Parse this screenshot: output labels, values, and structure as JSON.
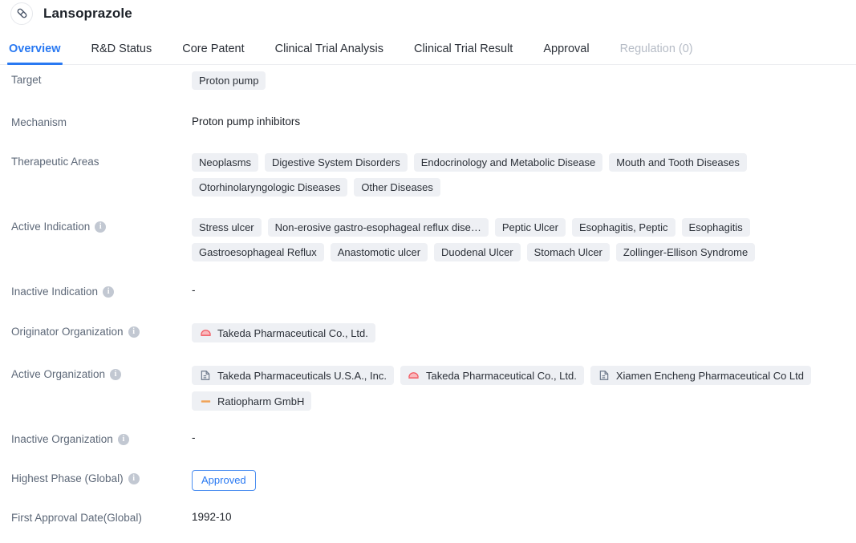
{
  "header": {
    "drug_name": "Lansoprazole",
    "avatar_icon": "capsule-pill-icon"
  },
  "tabs": [
    {
      "label": "Overview",
      "state": "active"
    },
    {
      "label": "R&D Status",
      "state": "normal"
    },
    {
      "label": "Core Patent",
      "state": "normal"
    },
    {
      "label": "Clinical Trial Analysis",
      "state": "normal"
    },
    {
      "label": "Clinical Trial Result",
      "state": "normal"
    },
    {
      "label": "Approval",
      "state": "normal"
    },
    {
      "label": "Regulation (0)",
      "state": "disabled"
    }
  ],
  "colors": {
    "accent": "#2979f2",
    "chip_bg": "#eef0f4",
    "label_text": "#5d6878",
    "value_text": "#20242b",
    "disabled_text": "#b6bcc6",
    "takeda_logo": "#f2565f",
    "ratiopharm_logo": "#f0a257",
    "company_icon": "#6b7789"
  },
  "rows": {
    "target": {
      "label": "Target",
      "chips": [
        "Proton pump"
      ]
    },
    "mechanism": {
      "label": "Mechanism",
      "text": "Proton pump inhibitors"
    },
    "therapeutic_areas": {
      "label": "Therapeutic Areas",
      "chips": [
        "Neoplasms",
        "Digestive System Disorders",
        "Endocrinology and Metabolic Disease",
        "Mouth and Tooth Diseases",
        "Otorhinolaryngologic Diseases",
        "Other Diseases"
      ]
    },
    "active_indication": {
      "label": "Active Indication",
      "info": "i",
      "chips": [
        "Stress ulcer",
        "Non-erosive gastro-esophageal reflux dise…",
        "Peptic Ulcer",
        "Esophagitis, Peptic",
        "Esophagitis",
        "Gastroesophageal Reflux",
        "Anastomotic ulcer",
        "Duodenal Ulcer",
        "Stomach Ulcer",
        "Zollinger-Ellison Syndrome"
      ]
    },
    "inactive_indication": {
      "label": "Inactive Indication",
      "info": "i",
      "text": "-"
    },
    "originator_organization": {
      "label": "Originator Organization",
      "info": "i",
      "chips": [
        {
          "text": "Takeda Pharmaceutical Co., Ltd.",
          "logo": "takeda-logo-icon"
        }
      ]
    },
    "active_organization": {
      "label": "Active Organization",
      "info": "i",
      "chips": [
        {
          "text": "Takeda Pharmaceuticals U.S.A., Inc.",
          "logo": "company-building-icon"
        },
        {
          "text": "Takeda Pharmaceutical Co., Ltd.",
          "logo": "takeda-logo-icon"
        },
        {
          "text": "Xiamen Encheng Pharmaceutical Co Ltd",
          "logo": "company-building-icon"
        },
        {
          "text": "Ratiopharm GmbH",
          "logo": "ratiopharm-logo-icon"
        }
      ]
    },
    "inactive_organization": {
      "label": "Inactive Organization",
      "info": "i",
      "text": "-"
    },
    "highest_phase": {
      "label": "Highest Phase (Global)",
      "info": "i",
      "badge": "Approved"
    },
    "first_approval_date": {
      "label": "First Approval Date(Global)",
      "text": "1992-10"
    }
  }
}
